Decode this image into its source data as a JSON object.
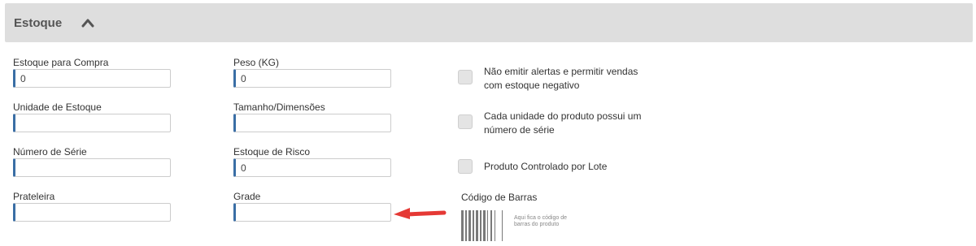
{
  "panel": {
    "title": "Estoque",
    "toggle_icon": "chevron-up-icon"
  },
  "fields": {
    "estoque_compra": {
      "label": "Estoque para Compra",
      "value": "0"
    },
    "peso": {
      "label": "Peso (KG)",
      "value": "0"
    },
    "unidade_estoque": {
      "label": "Unidade de Estoque",
      "value": ""
    },
    "tamanho": {
      "label": "Tamanho/Dimensões",
      "value": ""
    },
    "numero_serie": {
      "label": "Número de Série",
      "value": ""
    },
    "estoque_risco": {
      "label": "Estoque de Risco",
      "value": "0"
    },
    "prateleira": {
      "label": "Prateleira",
      "value": ""
    },
    "grade": {
      "label": "Grade",
      "value": ""
    }
  },
  "checkboxes": {
    "alertas": {
      "label": "Não emitir alertas e permitir vendas com estoque negativo",
      "checked": false
    },
    "serie": {
      "label": "Cada unidade do produto possui um número de série",
      "checked": false
    },
    "lote": {
      "label": "Produto Controlado por Lote",
      "checked": false
    }
  },
  "barcode": {
    "label": "Código de Barras",
    "caption": "Aqui fica o código de barras do produto",
    "icon": "barcode-icon"
  },
  "annotation": {
    "icon": "red-arrow-icon",
    "color": "#e53935"
  },
  "colors": {
    "header_bg": "#dedede",
    "input_accent": "#3a6ea5"
  }
}
